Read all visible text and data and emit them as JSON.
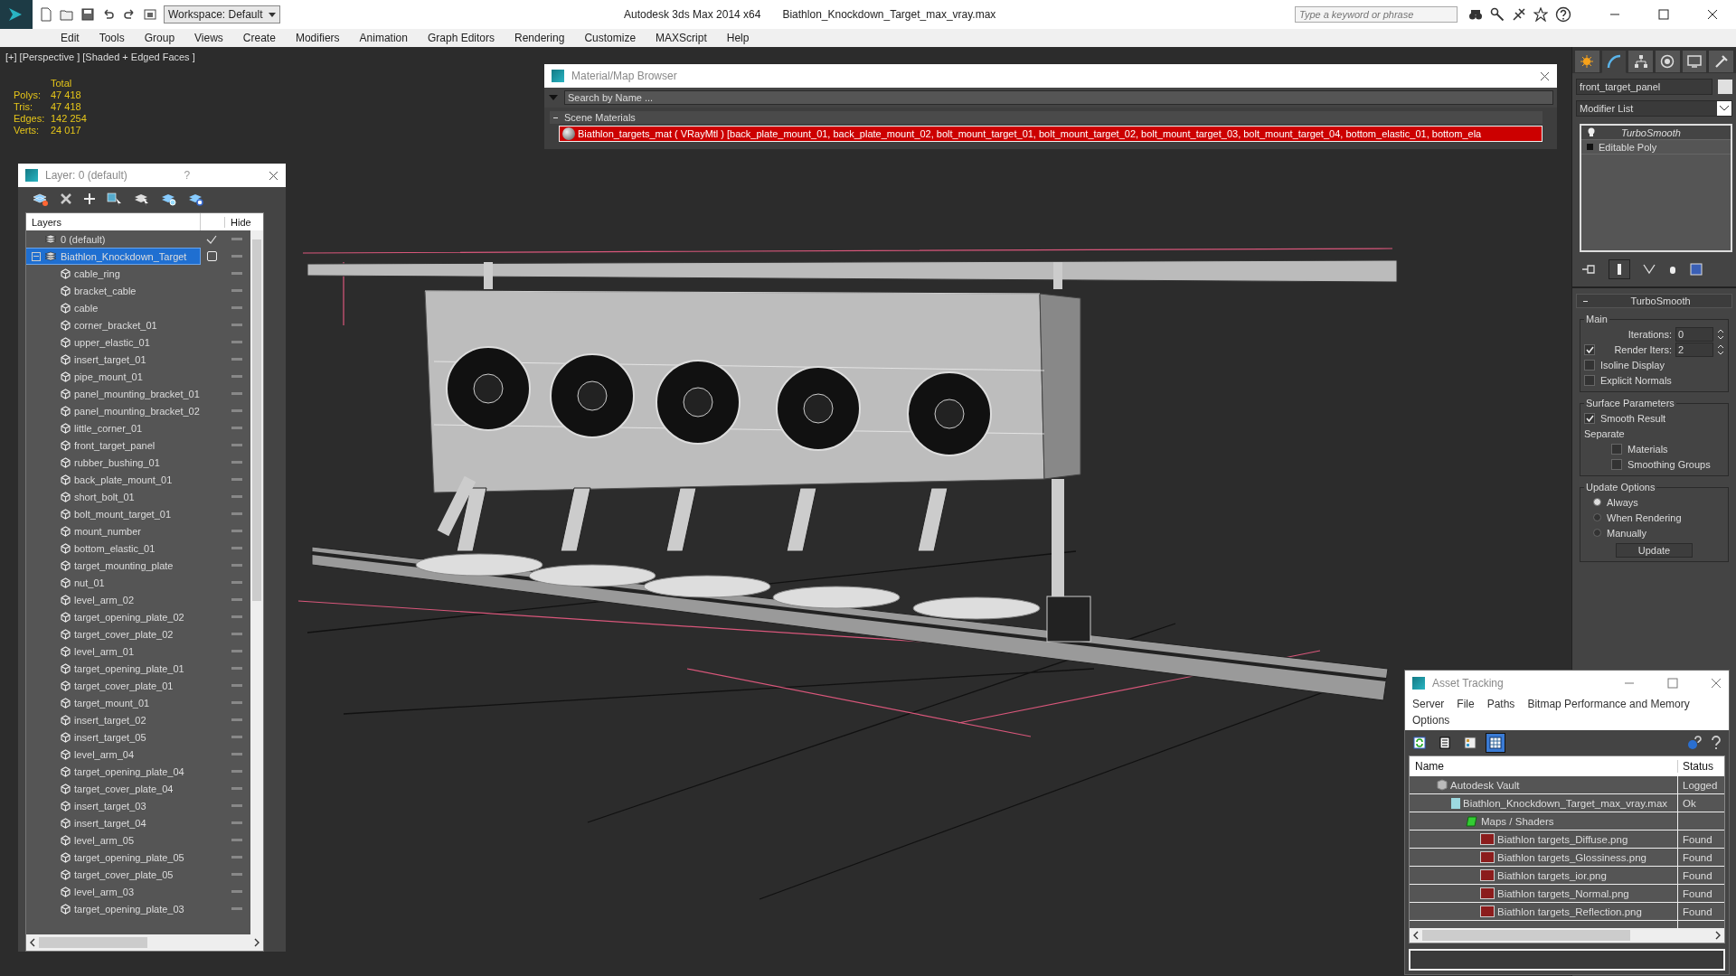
{
  "title_bar": {
    "workspace": "Workspace: Default",
    "title": "Autodesk 3ds Max  2014 x64",
    "filename": "Biathlon_Knockdown_Target_max_vray.max",
    "search_placeholder": "Type a keyword or phrase"
  },
  "menu": [
    "Edit",
    "Tools",
    "Group",
    "Views",
    "Create",
    "Modifiers",
    "Animation",
    "Graph Editors",
    "Rendering",
    "Customize",
    "MAXScript",
    "Help"
  ],
  "viewport": {
    "label": "[+] [Perspective ] [Shaded + Edged Faces ]",
    "stats_heading": "Total",
    "stats": [
      {
        "label": "Polys:",
        "value": "47 418"
      },
      {
        "label": "Tris:",
        "value": "47 418"
      },
      {
        "label": "Edges:",
        "value": "142 254"
      },
      {
        "label": "Verts:",
        "value": "24 017"
      }
    ]
  },
  "layer_window": {
    "title": "Layer: 0 (default)",
    "help": "?",
    "columns": [
      "Layers",
      "Hide"
    ],
    "layers": [
      {
        "name": "0 (default)",
        "current": true,
        "selected": false
      },
      {
        "name": "Biathlon_Knockdown_Target",
        "current": false,
        "selected": true,
        "expanded": true,
        "children": [
          {
            "name": "cable_ring",
            "selected": false
          },
          {
            "name": "bracket_cable",
            "selected": false
          },
          {
            "name": "cable",
            "selected": false
          },
          {
            "name": "corner_bracket_01",
            "selected": false
          },
          {
            "name": "upper_elastic_01",
            "selected": false
          },
          {
            "name": "insert_target_01",
            "selected": false
          },
          {
            "name": "pipe_mount_01",
            "selected": false
          },
          {
            "name": "panel_mounting_bracket_01",
            "selected": false
          },
          {
            "name": "panel_mounting_bracket_02",
            "selected": false
          },
          {
            "name": "little_corner_01",
            "selected": false
          },
          {
            "name": "front_target_panel",
            "selected": false
          },
          {
            "name": "rubber_bushing_01",
            "selected": false
          },
          {
            "name": "back_plate_mount_01",
            "selected": false
          },
          {
            "name": "short_bolt_01",
            "selected": false
          },
          {
            "name": "bolt_mount_target_01",
            "selected": false
          },
          {
            "name": "mount_number",
            "selected": false
          },
          {
            "name": "bottom_elastic_01",
            "selected": false
          },
          {
            "name": "target_mounting_plate",
            "selected": false
          },
          {
            "name": "nut_01",
            "selected": false
          },
          {
            "name": "level_arm_02",
            "selected": false
          },
          {
            "name": "target_opening_plate_02",
            "selected": false
          },
          {
            "name": "target_cover_plate_02",
            "selected": false
          },
          {
            "name": "level_arm_01",
            "selected": false
          },
          {
            "name": "target_opening_plate_01",
            "selected": false
          },
          {
            "name": "target_cover_plate_01",
            "selected": false
          },
          {
            "name": "target_mount_01",
            "selected": false
          },
          {
            "name": "insert_target_02",
            "selected": false
          },
          {
            "name": "insert_target_05",
            "selected": false
          },
          {
            "name": "level_arm_04",
            "selected": false
          },
          {
            "name": "target_opening_plate_04",
            "selected": false
          },
          {
            "name": "target_cover_plate_04",
            "selected": false
          },
          {
            "name": "insert_target_03",
            "selected": false
          },
          {
            "name": "insert_target_04",
            "selected": false
          },
          {
            "name": "level_arm_05",
            "selected": false
          },
          {
            "name": "target_opening_plate_05",
            "selected": false
          },
          {
            "name": "target_cover_plate_05",
            "selected": false
          },
          {
            "name": "level_arm_03",
            "selected": false
          },
          {
            "name": "target_opening_plate_03",
            "selected": false
          }
        ]
      }
    ]
  },
  "material_browser": {
    "title": "Material/Map Browser",
    "search_placeholder": "Search by Name ...",
    "group": "Scene Materials",
    "expanded": true,
    "material": "Biathlon_targets_mat ( VRayMtl ) [back_plate_mount_01, back_plate_mount_02, bolt_mount_target_01, bolt_mount_target_02, bolt_mount_target_03, bolt_mount_target_04, bottom_elastic_01, bottom_ela"
  },
  "command_panel": {
    "tabs": [
      {
        "kind": "create",
        "selected": false
      },
      {
        "kind": "modify",
        "selected": true
      },
      {
        "kind": "hierarchy",
        "selected": false
      },
      {
        "kind": "motion",
        "selected": false
      },
      {
        "kind": "display",
        "selected": false
      },
      {
        "kind": "utilities",
        "selected": false
      }
    ],
    "object_name": "front_target_panel",
    "modifier_list": "Modifier List",
    "stack": [
      {
        "name": "TurboSmooth",
        "kind": "modifier",
        "selected": true
      },
      {
        "name": "Editable Poly",
        "kind": "base",
        "selected": false
      }
    ],
    "rollout": {
      "title": "TurboSmooth",
      "expanded": true,
      "groups": [
        {
          "label": "Main",
          "controls": [
            {
              "kind": "spinner",
              "label": "Iterations:",
              "value": "0"
            },
            {
              "kind": "check_spinner",
              "label": "Render Iters:",
              "checked": true,
              "value": "2"
            },
            {
              "kind": "checkbox",
              "label": "Isoline Display",
              "checked": false
            },
            {
              "kind": "checkbox",
              "label": "Explicit Normals",
              "checked": false
            }
          ]
        },
        {
          "label": "Surface Parameters",
          "controls": [
            {
              "kind": "checkbox",
              "label": "Smooth Result",
              "checked": true
            },
            {
              "kind": "text",
              "label": "Separate"
            },
            {
              "kind": "sub_checkbox",
              "label": "Materials",
              "checked": false
            },
            {
              "kind": "sub_checkbox",
              "label": "Smoothing Groups",
              "checked": false
            }
          ]
        },
        {
          "label": "Update Options",
          "controls": [
            {
              "kind": "radio",
              "label": "Always",
              "selected": true
            },
            {
              "kind": "radio",
              "label": "When Rendering",
              "selected": false
            },
            {
              "kind": "radio",
              "label": "Manually",
              "selected": false
            },
            {
              "kind": "button",
              "label": "Update"
            }
          ]
        }
      ]
    }
  },
  "asset_tracking": {
    "title": "Asset Tracking",
    "menu": [
      "Server",
      "File",
      "Paths",
      "Bitmap Performance and Memory",
      "Options"
    ],
    "toolbar": [
      {
        "kind": "refresh",
        "selected": false
      },
      {
        "kind": "list",
        "selected": false
      },
      {
        "kind": "thumbnails",
        "selected": false
      },
      {
        "kind": "table",
        "selected": true
      }
    ],
    "columns": [
      "Name",
      "Status"
    ],
    "rows": [
      {
        "kind": "vault",
        "name": "Autodesk Vault",
        "status": "Logged",
        "children": [
          {
            "kind": "max",
            "name": "Biathlon_Knockdown_Target_max_vray.max",
            "status": "Ok",
            "children": [
              {
                "kind": "folder",
                "name": "Maps / Shaders",
                "children": [
                  {
                    "kind": "png",
                    "name": "Biathlon targets_Diffuse.png",
                    "status": "Found"
                  },
                  {
                    "kind": "png",
                    "name": "Biathlon targets_Glossiness.png",
                    "status": "Found"
                  },
                  {
                    "kind": "png",
                    "name": "Biathlon targets_ior.png",
                    "status": "Found"
                  },
                  {
                    "kind": "png",
                    "name": "Biathlon targets_Normal.png",
                    "status": "Found"
                  },
                  {
                    "kind": "png",
                    "name": "Biathlon targets_Reflection.png",
                    "status": "Found"
                  }
                ]
              }
            ]
          }
        ]
      }
    ]
  }
}
